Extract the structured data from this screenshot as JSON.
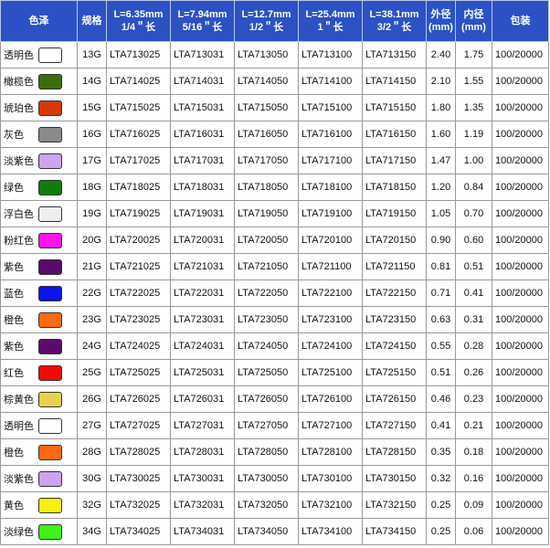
{
  "headers": [
    {
      "l1": "色泽",
      "l2": ""
    },
    {
      "l1": "规格",
      "l2": ""
    },
    {
      "l1": "L=6.35mm",
      "l2": "1/4＂长"
    },
    {
      "l1": "L=7.94mm",
      "l2": "5/16＂长"
    },
    {
      "l1": "L=12.7mm",
      "l2": "1/2＂长"
    },
    {
      "l1": "L=25.4mm",
      "l2": "1＂长"
    },
    {
      "l1": "L=38.1mm",
      "l2": "3/2＂长"
    },
    {
      "l1": "外径",
      "l2": "(mm)"
    },
    {
      "l1": "内径",
      "l2": "(mm)"
    },
    {
      "l1": "包装",
      "l2": ""
    }
  ],
  "rows": [
    {
      "color_name": "透明色",
      "swatch": "#ffffff",
      "spec": "13G",
      "c1": "LTA713025",
      "c2": "LTA713031",
      "c3": "LTA713050",
      "c4": "LTA713100",
      "c5": "LTA713150",
      "od": "2.40",
      "id": "1.75",
      "pack": "100/20000"
    },
    {
      "color_name": "橄榄色",
      "swatch": "#3a6e0c",
      "spec": "14G",
      "c1": "LTA714025",
      "c2": "LTA714031",
      "c3": "LTA714050",
      "c4": "LTA714100",
      "c5": "LTA714150",
      "od": "2.10",
      "id": "1.55",
      "pack": "100/20000"
    },
    {
      "color_name": "琥珀色",
      "swatch": "#d43a08",
      "spec": "15G",
      "c1": "LTA715025",
      "c2": "LTA715031",
      "c3": "LTA715050",
      "c4": "LTA715100",
      "c5": "LTA715150",
      "od": "1.80",
      "id": "1.35",
      "pack": "100/20000"
    },
    {
      "color_name": "灰色",
      "swatch": "#8a8a8a",
      "spec": "16G",
      "c1": "LTA716025",
      "c2": "LTA716031",
      "c3": "LTA716050",
      "c4": "LTA716100",
      "c5": "LTA716150",
      "od": "1.60",
      "id": "1.19",
      "pack": "100/20000"
    },
    {
      "color_name": "淡紫色",
      "swatch": "#cfa2f0",
      "spec": "17G",
      "c1": "LTA717025",
      "c2": "LTA717031",
      "c3": "LTA717050",
      "c4": "LTA717100",
      "c5": "LTA717150",
      "od": "1.47",
      "id": "1.00",
      "pack": "100/20000"
    },
    {
      "color_name": "绿色",
      "swatch": "#0e7d0e",
      "spec": "18G",
      "c1": "LTA718025",
      "c2": "LTA718031",
      "c3": "LTA718050",
      "c4": "LTA718100",
      "c5": "LTA718150",
      "od": "1.20",
      "id": "0.84",
      "pack": "100/20000"
    },
    {
      "color_name": "浮白色",
      "swatch": "#eeeeee",
      "spec": "19G",
      "c1": "LTA719025",
      "c2": "LTA719031",
      "c3": "LTA719050",
      "c4": "LTA719100",
      "c5": "LTA719150",
      "od": "1.05",
      "id": "0.70",
      "pack": "100/20000"
    },
    {
      "color_name": "粉红色",
      "swatch": "#ff14e6",
      "spec": "20G",
      "c1": "LTA720025",
      "c2": "LTA720031",
      "c3": "LTA720050",
      "c4": "LTA720100",
      "c5": "LTA720150",
      "od": "0.90",
      "id": "0.60",
      "pack": "100/20000"
    },
    {
      "color_name": "紫色",
      "swatch": "#5a0a6a",
      "spec": "21G",
      "c1": "LTA721025",
      "c2": "LTA721031",
      "c3": "LTA721050",
      "c4": "LTA721100",
      "c5": "LTA721150",
      "od": "0.81",
      "id": "0.51",
      "pack": "100/20000"
    },
    {
      "color_name": "蓝色",
      "swatch": "#0a14f0",
      "spec": "22G",
      "c1": "LTA722025",
      "c2": "LTA722031",
      "c3": "LTA722050",
      "c4": "LTA722100",
      "c5": "LTA722150",
      "od": "0.71",
      "id": "0.41",
      "pack": "100/20000"
    },
    {
      "color_name": "橙色",
      "swatch": "#ff6a10",
      "spec": "23G",
      "c1": "LTA723025",
      "c2": "LTA723031",
      "c3": "LTA723050",
      "c4": "LTA723100",
      "c5": "LTA723150",
      "od": "0.63",
      "id": "0.31",
      "pack": "100/20000"
    },
    {
      "color_name": "紫色",
      "swatch": "#5a0a6a",
      "spec": "24G",
      "c1": "LTA724025",
      "c2": "LTA724031",
      "c3": "LTA724050",
      "c4": "LTA724100",
      "c5": "LTA724150",
      "od": "0.55",
      "id": "0.28",
      "pack": "100/20000"
    },
    {
      "color_name": "红色",
      "swatch": "#f20a0a",
      "spec": "25G",
      "c1": "LTA725025",
      "c2": "LTA725031",
      "c3": "LTA725050",
      "c4": "LTA725100",
      "c5": "LTA725150",
      "od": "0.51",
      "id": "0.26",
      "pack": "100/20000"
    },
    {
      "color_name": "棕黄色",
      "swatch": "#e6d24a",
      "spec": "26G",
      "c1": "LTA726025",
      "c2": "LTA726031",
      "c3": "LTA726050",
      "c4": "LTA726100",
      "c5": "LTA726150",
      "od": "0.46",
      "id": "0.23",
      "pack": "100/20000"
    },
    {
      "color_name": "透明色",
      "swatch": "#ffffff",
      "spec": "27G",
      "c1": "LTA727025",
      "c2": "LTA727031",
      "c3": "LTA727050",
      "c4": "LTA727100",
      "c5": "LTA727150",
      "od": "0.41",
      "id": "0.21",
      "pack": "100/20000"
    },
    {
      "color_name": "橙色",
      "swatch": "#ff6a10",
      "spec": "28G",
      "c1": "LTA728025",
      "c2": "LTA728031",
      "c3": "LTA728050",
      "c4": "LTA728100",
      "c5": "LTA728150",
      "od": "0.35",
      "id": "0.18",
      "pack": "100/20000"
    },
    {
      "color_name": "淡紫色",
      "swatch": "#cfa2f0",
      "spec": "30G",
      "c1": "LTA730025",
      "c2": "LTA730031",
      "c3": "LTA730050",
      "c4": "LTA730100",
      "c5": "LTA730150",
      "od": "0.32",
      "id": "0.16",
      "pack": "100/20000"
    },
    {
      "color_name": "黄色",
      "swatch": "#f6f20a",
      "spec": "32G",
      "c1": "LTA732025",
      "c2": "LTA732031",
      "c3": "LTA732050",
      "c4": "LTA732100",
      "c5": "LTA732150",
      "od": "0.25",
      "id": "0.09",
      "pack": "100/20000"
    },
    {
      "color_name": "淡绿色",
      "swatch": "#3ef21a",
      "spec": "34G",
      "c1": "LTA734025",
      "c2": "LTA734031",
      "c3": "LTA734050",
      "c4": "LTA734100",
      "c5": "LTA734150",
      "od": "0.25",
      "id": "0.06",
      "pack": "100/20000"
    }
  ]
}
